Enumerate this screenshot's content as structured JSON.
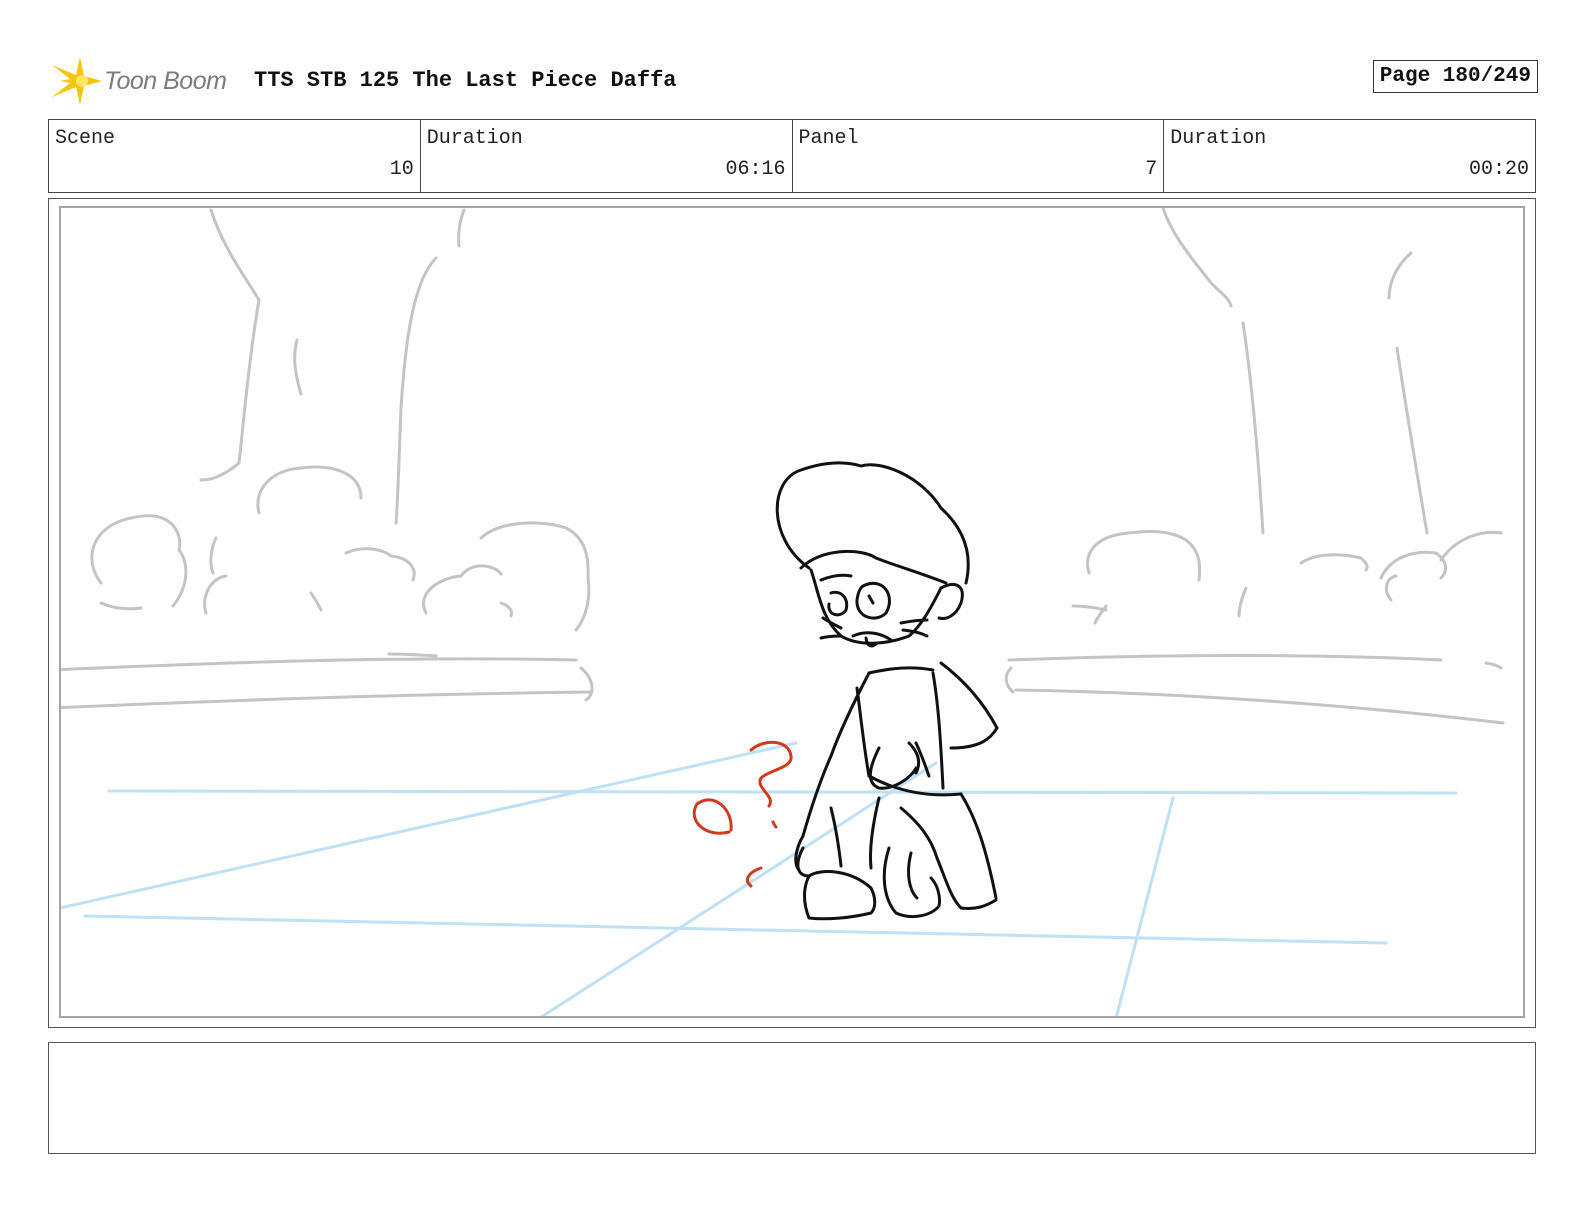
{
  "header": {
    "logo_text": "Toon Boom",
    "title": "TTS STB 125 The Last Piece Daffa",
    "page_label": "Page 180/249"
  },
  "info": {
    "scene_label": "Scene",
    "scene_value": "10",
    "scene_duration_label": "Duration",
    "scene_duration_value": "06:16",
    "panel_label": "Panel",
    "panel_value": "7",
    "panel_duration_label": "Duration",
    "panel_duration_value": "00:20"
  },
  "notes": {
    "text": ""
  },
  "colors": {
    "background_sketch": "#c4c4c4",
    "character_line": "#111111",
    "perspective_guide": "#bfe0f5",
    "action_marks": "#d23a1e",
    "logo_flare": "#f6c60e"
  }
}
